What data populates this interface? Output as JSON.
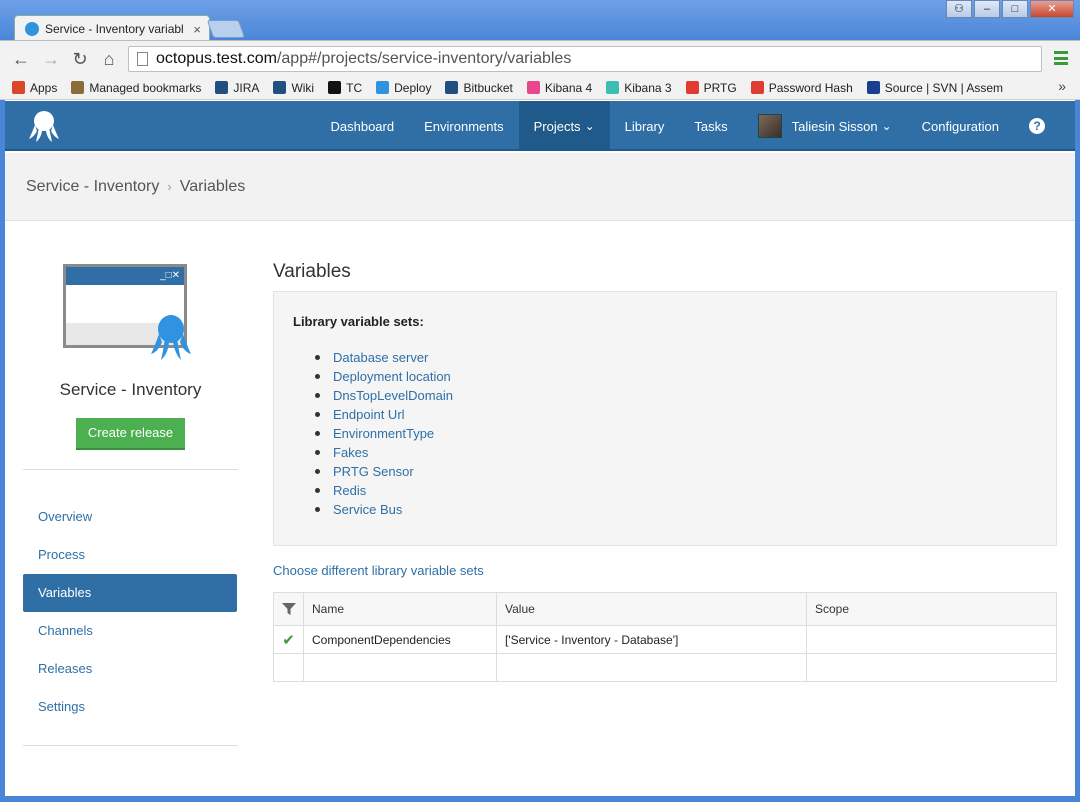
{
  "browser": {
    "tab_title": "Service - Inventory variabl",
    "tab_close": "×",
    "window_buttons": {
      "user": "⚇",
      "minimize": "–",
      "maximize": "□",
      "close": "✕"
    },
    "url_host": "octopus.test.com",
    "url_path": "/app#/projects/service-inventory/variables",
    "nav_icons": {
      "back": "←",
      "forward": "→",
      "reload": "↻",
      "home": "⌂"
    },
    "bookmarks": [
      {
        "label": "Apps",
        "icon": "apps-grid-icon",
        "color": "#d9472b"
      },
      {
        "label": "Managed bookmarks",
        "icon": "folder-icon",
        "color": "#8a6d3b"
      },
      {
        "label": "JIRA",
        "icon": "jira-icon",
        "color": "#205081"
      },
      {
        "label": "Wiki",
        "icon": "confluence-icon",
        "color": "#205081"
      },
      {
        "label": "TC",
        "icon": "teamcity-icon",
        "color": "#111111"
      },
      {
        "label": "Deploy",
        "icon": "octopus-icon",
        "color": "#2f93e0"
      },
      {
        "label": "Bitbucket",
        "icon": "bitbucket-icon",
        "color": "#205081"
      },
      {
        "label": "Kibana 4",
        "icon": "kibana-icon",
        "color": "#e8478b"
      },
      {
        "label": "Kibana 3",
        "icon": "kibana-icon",
        "color": "#3ebeb0"
      },
      {
        "label": "PRTG",
        "icon": "prtg-icon",
        "color": "#e03c31"
      },
      {
        "label": "Password Hash",
        "icon": "gauge-icon",
        "color": "#e03c31"
      },
      {
        "label": "Source | SVN | Assem",
        "icon": "assembla-icon",
        "color": "#1b3f8f"
      }
    ],
    "bookmarks_more": "»"
  },
  "header": {
    "nav": [
      {
        "label": "Dashboard",
        "active": false
      },
      {
        "label": "Environments",
        "active": false
      },
      {
        "label": "Projects",
        "active": true,
        "chevron": true
      },
      {
        "label": "Library",
        "active": false
      },
      {
        "label": "Tasks",
        "active": false
      }
    ],
    "user_name": "Taliesin Sisson",
    "configuration": "Configuration",
    "help": "?",
    "chevron": "⌄"
  },
  "breadcrumb": {
    "project": "Service - Inventory",
    "separator": "›",
    "current": "Variables"
  },
  "sidebar": {
    "project_name": "Service - Inventory",
    "create_release": "Create release",
    "window_controls": "_□✕",
    "menu": [
      {
        "label": "Overview",
        "active": false
      },
      {
        "label": "Process",
        "active": false
      },
      {
        "label": "Variables",
        "active": true
      },
      {
        "label": "Channels",
        "active": false
      },
      {
        "label": "Releases",
        "active": false
      },
      {
        "label": "Settings",
        "active": false
      }
    ]
  },
  "main": {
    "title": "Variables",
    "library_label": "Library variable sets:",
    "library_sets": [
      "Database server",
      "Deployment location",
      "DnsTopLevelDomain",
      "Endpoint Url",
      "EnvironmentType",
      "Fakes",
      "PRTG Sensor",
      "Redis",
      "Service Bus"
    ],
    "choose_link": "Choose different library variable sets",
    "table": {
      "columns": [
        "Name",
        "Value",
        "Scope"
      ],
      "rows": [
        {
          "valid": true,
          "check": "✔",
          "name": "ComponentDependencies",
          "value": "['Service - Inventory - Database']",
          "scope": ""
        }
      ]
    }
  },
  "colors": {
    "brand": "#2f6fa6",
    "button_green": "#4caf50",
    "check_green": "#3d9a3d"
  }
}
